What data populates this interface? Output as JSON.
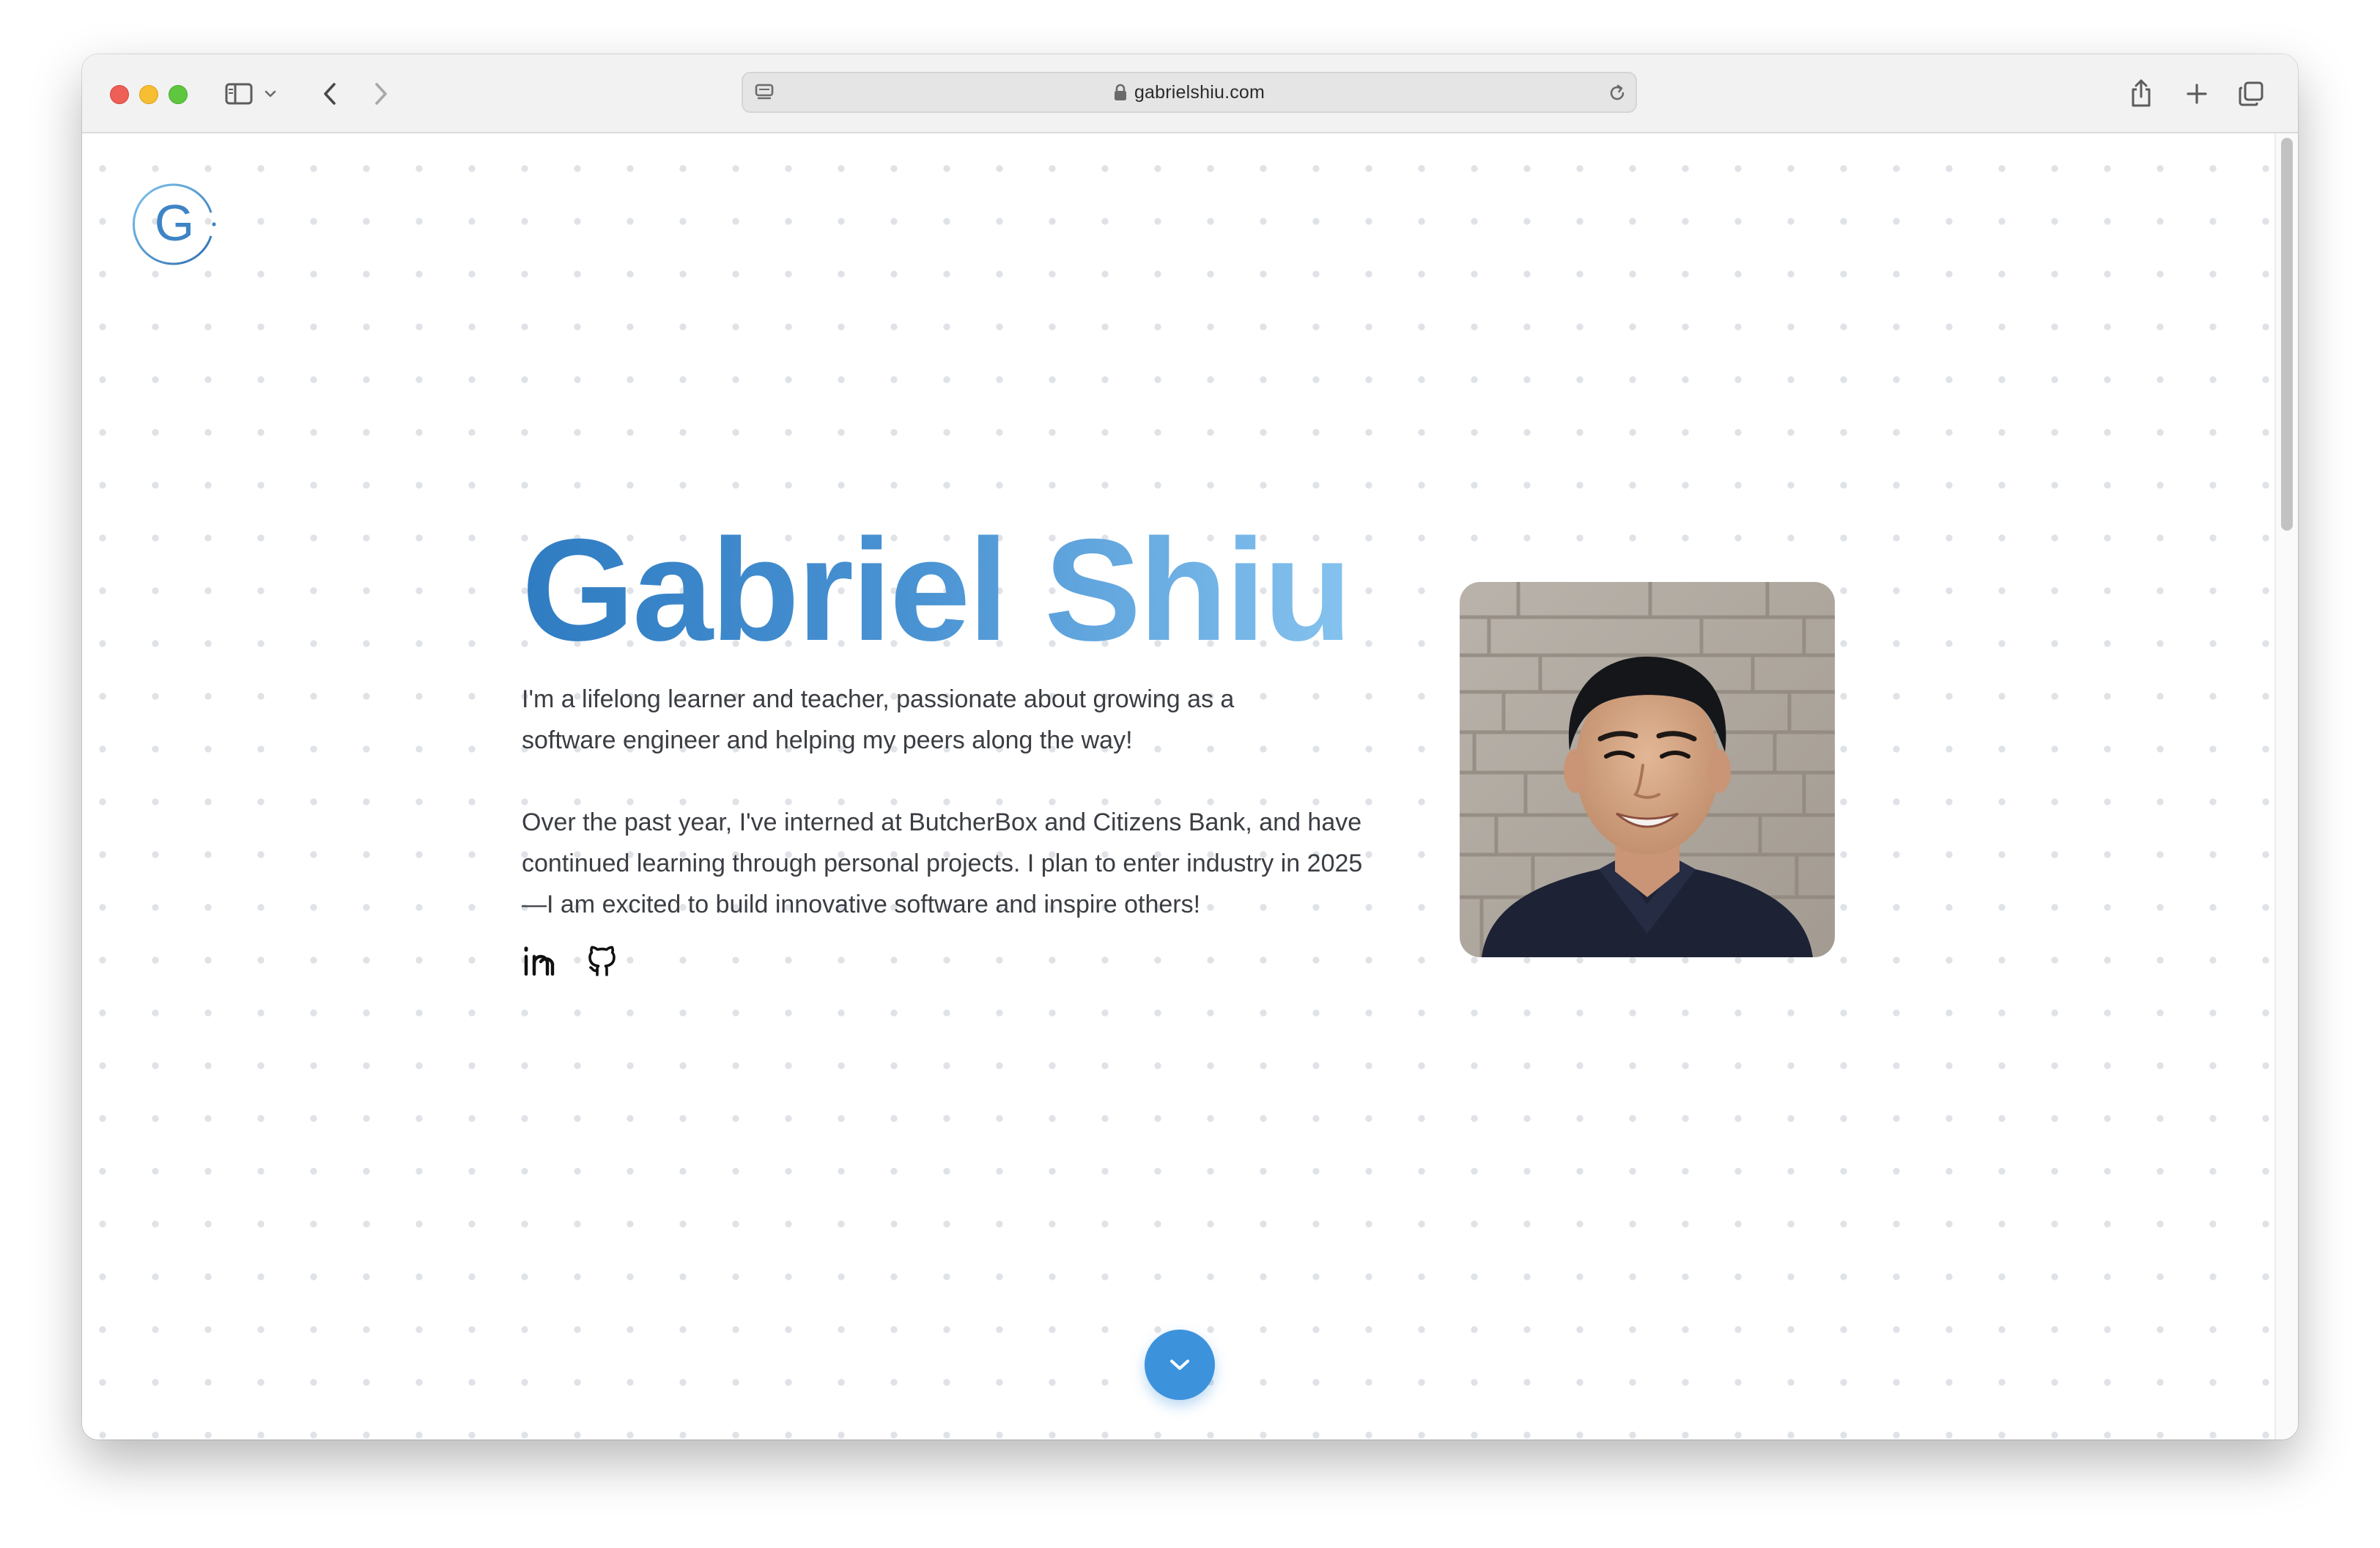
{
  "browser": {
    "url": "gabrielshiu.com",
    "controls": {
      "close": "close",
      "minimize": "minimize",
      "zoom": "zoom"
    },
    "icons": [
      "sidebar-icon",
      "chevron-down-icon",
      "back-icon",
      "forward-icon",
      "reader-icon",
      "lock-icon",
      "reload-icon",
      "share-icon",
      "new-tab-icon",
      "tab-overview-icon"
    ]
  },
  "site": {
    "logo_letter": "G",
    "hero": {
      "name": "Gabriel Shiu",
      "intro": "I'm a lifelong learner and teacher, passionate about growing as a software engineer and helping my peers along the way!",
      "about": "Over the past year, I've interned at ButcherBox and Citizens Bank, and have continued learning through personal projects. I plan to enter industry in 2025—I am excited to build innovative software and inspire others!",
      "socials": [
        "linkedin-icon",
        "github-icon"
      ]
    },
    "scroll_button_icon": "chevron-down-icon"
  },
  "colors": {
    "gradient_start": "#2f7cc2",
    "gradient_end": "#8cc8f2",
    "accent": "#3d92dc",
    "text": "#3a3d42"
  }
}
